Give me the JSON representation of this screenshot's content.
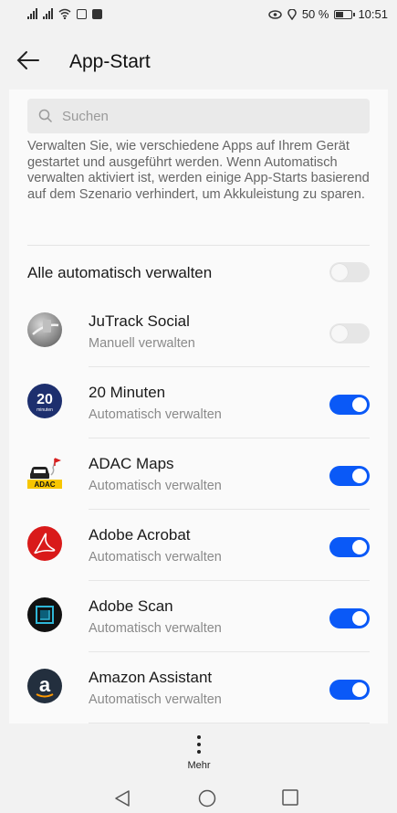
{
  "status_bar": {
    "battery_text": "50 %",
    "time": "10:51"
  },
  "header": {
    "title": "App-Start"
  },
  "search": {
    "placeholder": "Suchen"
  },
  "description": "Verwalten Sie, wie verschiedene Apps auf Ihrem Gerät gestartet und ausgeführt werden. Wenn Automatisch verwalten aktiviert ist, werden einige App-Starts basierend auf dem Szenario verhindert, um Akkuleistung zu sparen.",
  "all_auto": {
    "label": "Alle automatisch verwalten",
    "enabled": false
  },
  "apps": [
    {
      "name": "JuTrack Social",
      "status": "Manuell verwalten",
      "enabled": false,
      "icon": "jutrack-icon"
    },
    {
      "name": "20 Minuten",
      "status": "Automatisch verwalten",
      "enabled": true,
      "icon": "20-minuten-icon",
      "icon_text": "20",
      "icon_subtext": "minuten"
    },
    {
      "name": "ADAC Maps",
      "status": "Automatisch verwalten",
      "enabled": true,
      "icon": "adac-maps-icon",
      "icon_text": "ADAC"
    },
    {
      "name": "Adobe Acrobat",
      "status": "Automatisch verwalten",
      "enabled": true,
      "icon": "adobe-acrobat-icon"
    },
    {
      "name": "Adobe Scan",
      "status": "Automatisch verwalten",
      "enabled": true,
      "icon": "adobe-scan-icon"
    },
    {
      "name": "Amazon Assistant",
      "status": "Automatisch verwalten",
      "enabled": true,
      "icon": "amazon-assistant-icon",
      "icon_text": "a"
    }
  ],
  "bottom": {
    "more_label": "Mehr"
  },
  "colors": {
    "toggle_on": "#0a59f7",
    "toggle_off": "#e6e6e6"
  }
}
